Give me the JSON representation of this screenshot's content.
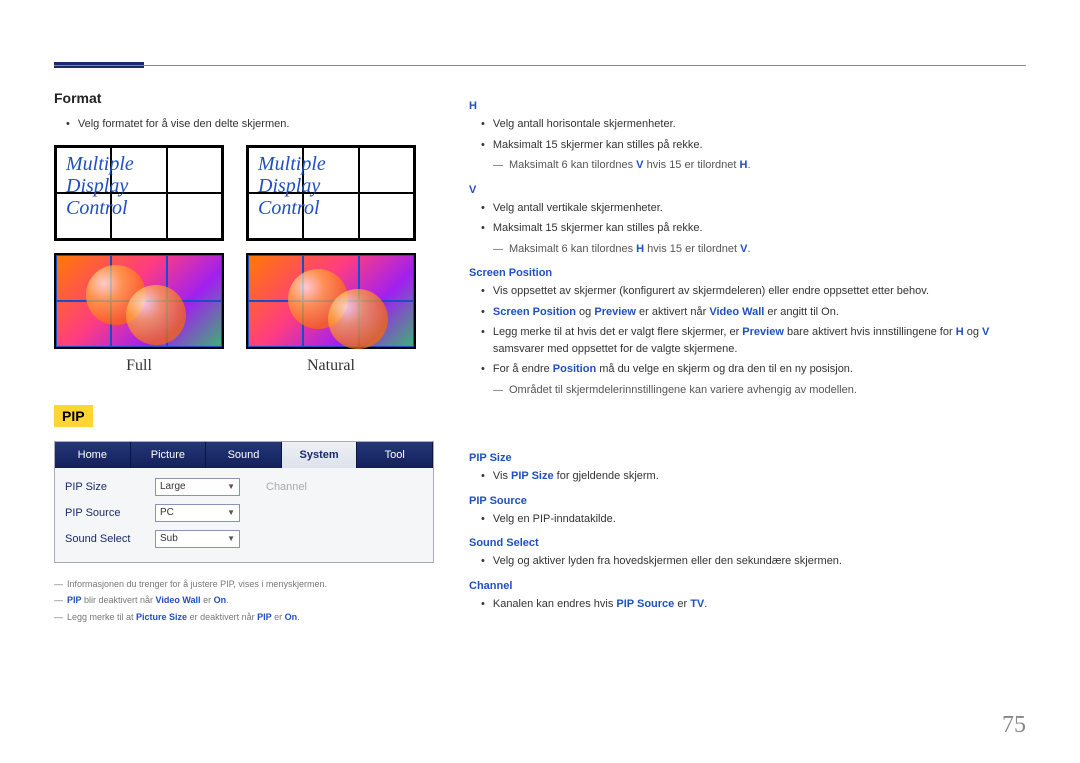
{
  "page_number": "75",
  "left": {
    "format_heading": "Format",
    "format_desc": "Velg formatet for å vise den delte skjermen.",
    "mdc_text": "Multiple\nDisplay\nControl",
    "label_full": "Full",
    "label_natural": "Natural",
    "pip_badge": "PIP",
    "tabs": {
      "home": "Home",
      "picture": "Picture",
      "sound": "Sound",
      "system": "System",
      "tool": "Tool"
    },
    "rows": {
      "pip_size_label": "PIP Size",
      "pip_size_value": "Large",
      "channel_label": "Channel",
      "pip_source_label": "PIP Source",
      "pip_source_value": "PC",
      "sound_select_label": "Sound Select",
      "sound_select_value": "Sub"
    },
    "notes": {
      "n1": "Informasjonen du trenger for å justere PIP, vises i menyskjermen.",
      "n2_prefix": "PIP",
      "n2_mid": " blir deaktivert når ",
      "n2_vw": "Video Wall",
      "n2_er": " er ",
      "n2_on": "On",
      "n2_end": ".",
      "n3_prefix": "Legg merke til at ",
      "n3_ps": "Picture Size",
      "n3_mid": " er deaktivert når ",
      "n3_pip": "PIP",
      "n3_er": " er ",
      "n3_on": "On",
      "n3_end": "."
    }
  },
  "right": {
    "h_head": "H",
    "h_b1": "Velg antall horisontale skjermenheter.",
    "h_b2": "Maksimalt 15 skjermer kan stilles på rekke.",
    "h_sub_prefix": "Maksimalt 6 kan tilordnes ",
    "h_sub_v": "V",
    "h_sub_mid": " hvis 15 er tilordnet ",
    "h_sub_h": "H",
    "h_sub_end": ".",
    "v_head": "V",
    "v_b1": "Velg antall vertikale skjermenheter.",
    "v_b2": "Maksimalt 15 skjermer kan stilles på rekke.",
    "v_sub_prefix": "Maksimalt 6 kan tilordnes ",
    "v_sub_h": "H",
    "v_sub_mid": " hvis 15 er tilordnet ",
    "v_sub_v": "V",
    "v_sub_end": ".",
    "sp_head": "Screen Position",
    "sp_b1": "Vis oppsettet av skjermer (konfigurert av skjermdeleren) eller endre oppsettet etter behov.",
    "sp_b2_sp": "Screen Position",
    "sp_b2_og": " og ",
    "sp_b2_pv": "Preview",
    "sp_b2_mid": " er aktivert når ",
    "sp_b2_vw": "Video Wall",
    "sp_b2_end": " er angitt til On.",
    "sp_b3_pre": "Legg merke til at hvis det er valgt flere skjermer, er ",
    "sp_b3_pv": "Preview",
    "sp_b3_mid": " bare aktivert hvis innstillingene for ",
    "sp_b3_h": "H",
    "sp_b3_og": " og ",
    "sp_b3_v": "V",
    "sp_b3_end": " samsvarer med oppsettet for de valgte skjermene.",
    "sp_b4_pre": "For å endre ",
    "sp_b4_pos": "Position",
    "sp_b4_end": " må du velge en skjerm og dra den til en ny posisjon.",
    "sp_sub": "Området til skjermdelerinnstillingene kan variere avhengig av modellen.",
    "ps_head": "PIP Size",
    "ps_b1_pre": "Vis ",
    "ps_b1_ps": "PIP Size",
    "ps_b1_end": " for gjeldende skjerm.",
    "psrc_head": "PIP Source",
    "psrc_b1": "Velg en PIP-inndatakilde.",
    "ss_head": "Sound Select",
    "ss_b1": "Velg og aktiver lyden fra hovedskjermen eller den sekundære skjermen.",
    "ch_head": "Channel",
    "ch_b1_pre": "Kanalen kan endres hvis ",
    "ch_b1_ps": "PIP Source",
    "ch_b1_er": " er ",
    "ch_b1_tv": "TV",
    "ch_b1_end": "."
  }
}
